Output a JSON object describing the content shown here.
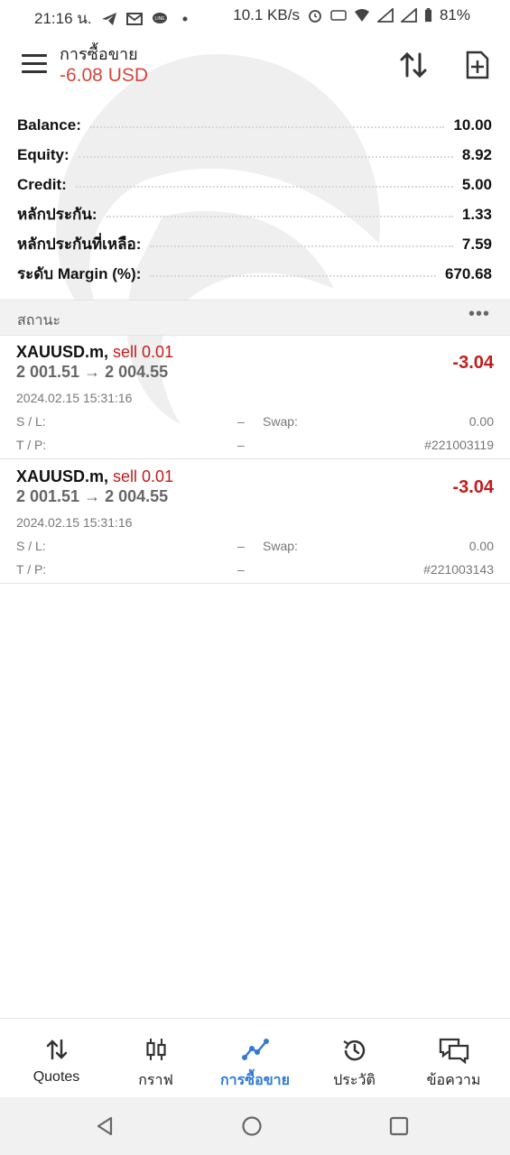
{
  "status_bar": {
    "time": "21:16 น.",
    "net_speed": "10.1 KB/s",
    "battery": "81%",
    "icons": [
      "telegram-icon",
      "gmail-icon",
      "line-icon",
      "dot-icon",
      "alarm-icon",
      "auto-icon",
      "wifi-icon",
      "signal-1-icon",
      "signal-2-icon",
      "battery-icon"
    ]
  },
  "header": {
    "title": "การซื้อขาย",
    "subtitle": "-6.08 USD",
    "accent_color": "#d9443b"
  },
  "summary": [
    {
      "label": "Balance:",
      "value": "10.00"
    },
    {
      "label": "Equity:",
      "value": "8.92"
    },
    {
      "label": "Credit:",
      "value": "5.00"
    },
    {
      "label": "หลักประกัน:",
      "value": "1.33"
    },
    {
      "label": "หลักประกันที่เหลือ:",
      "value": "7.59"
    },
    {
      "label": "ระดับ Margin (%):",
      "value": "670.68"
    }
  ],
  "positions_section": {
    "title": "สถานะ",
    "more_label": "•••"
  },
  "positions": [
    {
      "symbol": "XAUUSD.m,",
      "side": "sell 0.01",
      "prices": "2 001.51 → 2 004.55",
      "profit": "-3.04",
      "time": "2024.02.15 15:31:16",
      "sl_label": "S / L:",
      "sl_value": "–",
      "tp_label": "T / P:",
      "tp_value": "–",
      "swap_label": "Swap:",
      "swap_value": "0.00",
      "ticket": "#221003119"
    },
    {
      "symbol": "XAUUSD.m,",
      "side": "sell 0.01",
      "prices": "2 001.51 → 2 004.55",
      "profit": "-3.04",
      "time": "2024.02.15 15:31:16",
      "sl_label": "S / L:",
      "sl_value": "–",
      "tp_label": "T / P:",
      "tp_value": "–",
      "swap_label": "Swap:",
      "swap_value": "0.00",
      "ticket": "#221003143"
    }
  ],
  "bottom_nav": [
    {
      "label": "Quotes",
      "icon": "quotes-arrows-icon",
      "active": false
    },
    {
      "label": "กราฟ",
      "icon": "candlestick-icon",
      "active": false
    },
    {
      "label": "การซื้อขาย",
      "icon": "trade-line-icon",
      "active": true
    },
    {
      "label": "ประวัติ",
      "icon": "history-icon",
      "active": false
    },
    {
      "label": "ข้อความ",
      "icon": "messages-icon",
      "active": false
    }
  ],
  "colors": {
    "loss": "#c41b1b",
    "active_nav": "#2f7ad9"
  }
}
